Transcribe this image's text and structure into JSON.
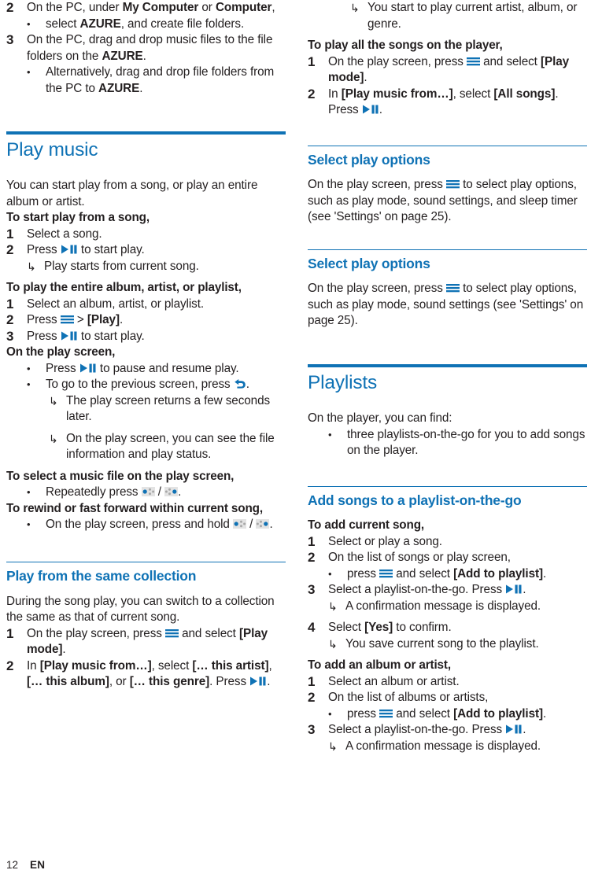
{
  "document": {
    "footer": {
      "page_number": "12",
      "language": "EN"
    },
    "accent_color": "#0f72b5",
    "text_color": "#231f20"
  },
  "icons": {
    "play_pause": "play-pause-icon",
    "menu": "menu-icon",
    "back": "back-arrow-icon",
    "prev": "previous-track-icon",
    "next": "next-track-icon",
    "result_arrow": "result-arrow-icon",
    "bullet": "bullet-dot-icon"
  },
  "left_column": {
    "step2": {
      "num": "2",
      "line1_a": "On the PC, under ",
      "line1_b": "My Computer",
      "line1_c": " or ",
      "line1_d": "Computer",
      "line1_e": ",",
      "bullet_a": "select ",
      "bullet_b": "AZURE",
      "bullet_c": ", and create file folders."
    },
    "step3": {
      "num": "3",
      "line_a": "On the PC, drag and drop music files to the file folders on the ",
      "line_b": "AZURE",
      "line_c": ".",
      "bullet_a": "Alternatively, drag and drop file folders from the PC to ",
      "bullet_b": "AZURE",
      "bullet_c": "."
    },
    "play_music": {
      "heading": "Play music",
      "intro": "You can start play from a song, or play an entire album or artist.",
      "sub1": "To start play from a song,",
      "s1_num": "1",
      "s1_text": "Select a song.",
      "s2_num": "2",
      "s2_a": "Press ",
      "s2_b": " to start play.",
      "s2_result": "Play starts from current song.",
      "sub2": "To play the entire album, artist, or playlist,",
      "p1_num": "1",
      "p1_text": "Select an album, artist, or playlist.",
      "p2_num": "2",
      "p2_a": "Press ",
      "p2_b": " > ",
      "p2_c": "[Play]",
      "p2_d": ".",
      "p3_num": "3",
      "p3_a": "Press ",
      "p3_b": " to start play.",
      "sub3": "On the play screen,",
      "b1_a": "Press ",
      "b1_b": " to pause and resume play.",
      "b2_a": "To go to the previous screen, press ",
      "b2_b": ".",
      "b2_r1": "The play screen returns a few seconds later.",
      "b2_r2": "On the play screen, you can see the file information and play status.",
      "sub4": "To select a music file on the play screen,",
      "b3_a": "Repeatedly press ",
      "b3_b": " / ",
      "b3_c": ".",
      "sub5": "To rewind or fast forward within current song,",
      "b4_a": "On the play screen, press and hold ",
      "b4_b": " / ",
      "b4_c": "."
    },
    "same_collection": {
      "heading": "Play from the same collection",
      "intro": "During the song play, you can switch to a collection the same as that of current song.",
      "s1_num": "1",
      "s1_a": "On the play screen, press ",
      "s1_b": " and select ",
      "s1_c": "[Play mode]",
      "s1_d": ".",
      "s2_num": "2",
      "s2_a": "In ",
      "s2_b": "[Play music from…]",
      "s2_c": ", select ",
      "s2_d": "[… this artist]",
      "s2_e": ", ",
      "s2_f": "[… this album]",
      "s2_g": ", or ",
      "s2_h": "[… this genre]",
      "s2_i": ". Press ",
      "s2_j": "."
    }
  },
  "right_column": {
    "top_result": "You start to play current artist, album, or genre.",
    "all_songs": {
      "sub": "To play all the songs on the player,",
      "s1_num": "1",
      "s1_a": "On the play screen, press ",
      "s1_b": " and select ",
      "s1_c": "[Play mode]",
      "s1_d": ".",
      "s2_num": "2",
      "s2_a": "In ",
      "s2_b": "[Play music from…]",
      "s2_c": ", select ",
      "s2_d": "[All songs]",
      "s2_e": ". Press ",
      "s2_f": "."
    },
    "select_play_options_1": {
      "heading": "Select play options",
      "body_a": "On the play screen, press ",
      "body_b": " to select play options, such as play mode, sound settings, and sleep timer (see 'Settings' on page 25)."
    },
    "select_play_options_2": {
      "heading": "Select play options",
      "body_a": "On the play screen, press ",
      "body_b": " to select play options, such as play mode, sound settings (see 'Settings' on page 25)."
    },
    "playlists": {
      "heading": "Playlists",
      "intro": "On the player, you can find:",
      "bullet": "three playlists-on-the-go for you to add songs on the player."
    },
    "add_songs": {
      "heading": "Add songs to a playlist-on-the-go",
      "sub1": "To add current song,",
      "a1_num": "1",
      "a1_text": "Select or play a song.",
      "a2_num": "2",
      "a2_text": "On the list of songs or play screen,",
      "a2_b_a": "press ",
      "a2_b_b": " and select ",
      "a2_b_c": "[Add to playlist]",
      "a2_b_d": ".",
      "a3_num": "3",
      "a3_a": "Select a playlist-on-the-go. Press ",
      "a3_b": ".",
      "a3_result": "A confirmation message is displayed.",
      "a4_num": "4",
      "a4_a": "Select ",
      "a4_b": "[Yes]",
      "a4_c": " to confirm.",
      "a4_result": "You save current song to the playlist.",
      "sub2": "To add an album or artist,",
      "b1_num": "1",
      "b1_text": "Select an album or artist.",
      "b2_num": "2",
      "b2_text": "On the list of albums or artists,",
      "b2_b_a": "press ",
      "b2_b_b": " and select ",
      "b2_b_c": "[Add to playlist]",
      "b2_b_d": ".",
      "b3_num": "3",
      "b3_a": "Select a playlist-on-the-go. Press ",
      "b3_b": ".",
      "b3_result": "A confirmation message is displayed."
    }
  }
}
